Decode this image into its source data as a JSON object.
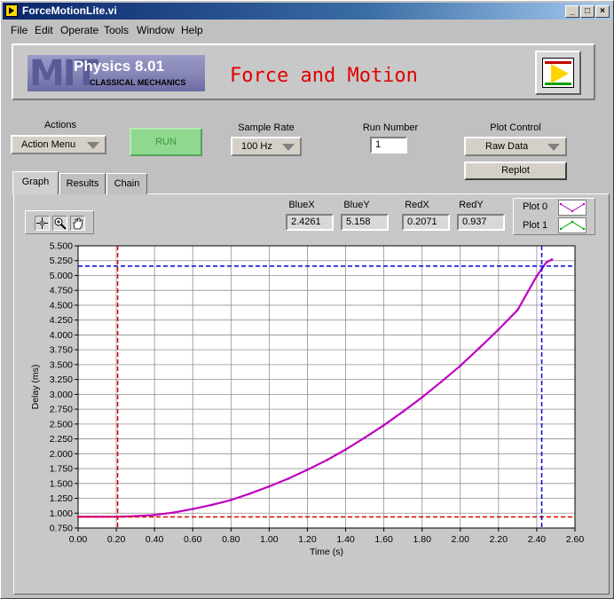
{
  "window": {
    "title": "ForceMotionLite.vi",
    "controls": [
      "_",
      "□",
      "×"
    ]
  },
  "menu": [
    "File",
    "Edit",
    "Operate",
    "Tools",
    "Window",
    "Help"
  ],
  "header": {
    "logo_mit": "MIT",
    "logo_course": "Physics 8.01",
    "logo_subtitle": "CLASSICAL MECHANICS",
    "title": "Force and Motion"
  },
  "controls": {
    "actions_label": "Actions",
    "actions_value": "Action Menu",
    "run_label": "RUN",
    "sample_rate_label": "Sample Rate",
    "sample_rate_value": "100 Hz",
    "run_number_label": "Run Number",
    "run_number_value": "1",
    "plot_control_label": "Plot Control",
    "plot_control_value": "Raw Data",
    "replot_label": "Replot"
  },
  "tabs": [
    "Graph",
    "Results",
    "Chain"
  ],
  "active_tab": "Graph",
  "cursors": {
    "bluex_label": "BlueX",
    "bluex_value": "2.4261",
    "bluey_label": "BlueY",
    "bluey_value": "5.158",
    "redx_label": "RedX",
    "redx_value": "0.2071",
    "redy_label": "RedY",
    "redy_value": "0.937"
  },
  "legend": {
    "plot0": "Plot 0",
    "plot1": "Plot 1",
    "plot0_color": "#c000c0",
    "plot1_color": "#00a000"
  },
  "palette_icons": [
    "crosshair-icon",
    "zoom-icon",
    "hand-icon"
  ],
  "colors": {
    "trace": "#c000c0",
    "blue_cursor": "#0000e0",
    "red_cursor": "#e00000",
    "run_button": "#8fd88f"
  },
  "chart_data": {
    "type": "line",
    "xlabel": "Time (s)",
    "ylabel": "Delay (ms)",
    "xlim": [
      0,
      2.6
    ],
    "ylim": [
      0.75,
      5.5
    ],
    "x_ticks": [
      "0.00",
      "0.20",
      "0.40",
      "0.60",
      "0.80",
      "1.00",
      "1.20",
      "1.40",
      "1.60",
      "1.80",
      "2.00",
      "2.20",
      "2.40",
      "2.60"
    ],
    "y_ticks": [
      "0.750",
      "1.000",
      "1.250",
      "1.500",
      "1.750",
      "2.000",
      "2.250",
      "2.500",
      "2.750",
      "3.000",
      "3.250",
      "3.500",
      "3.750",
      "4.000",
      "4.250",
      "4.500",
      "4.750",
      "5.000",
      "5.250",
      "5.500"
    ],
    "grid": true,
    "series": [
      {
        "x": [
          0.0,
          0.1,
          0.2,
          0.3,
          0.4,
          0.5,
          0.6,
          0.7,
          0.8,
          0.9,
          1.0,
          1.1,
          1.2,
          1.3,
          1.4,
          1.5,
          1.6,
          1.7,
          1.8,
          1.9,
          2.0,
          2.1,
          2.2,
          2.3,
          2.4,
          2.45,
          2.48
        ],
        "y": [
          0.94,
          0.94,
          0.94,
          0.95,
          0.97,
          1.01,
          1.07,
          1.14,
          1.22,
          1.33,
          1.45,
          1.58,
          1.73,
          1.89,
          2.07,
          2.27,
          2.48,
          2.71,
          2.95,
          3.21,
          3.48,
          3.78,
          4.09,
          4.42,
          4.99,
          5.22,
          5.27
        ]
      }
    ],
    "cursors": {
      "blue": {
        "x": 2.4261,
        "y": 5.158
      },
      "red": {
        "x": 0.2071,
        "y": 0.937
      }
    }
  }
}
